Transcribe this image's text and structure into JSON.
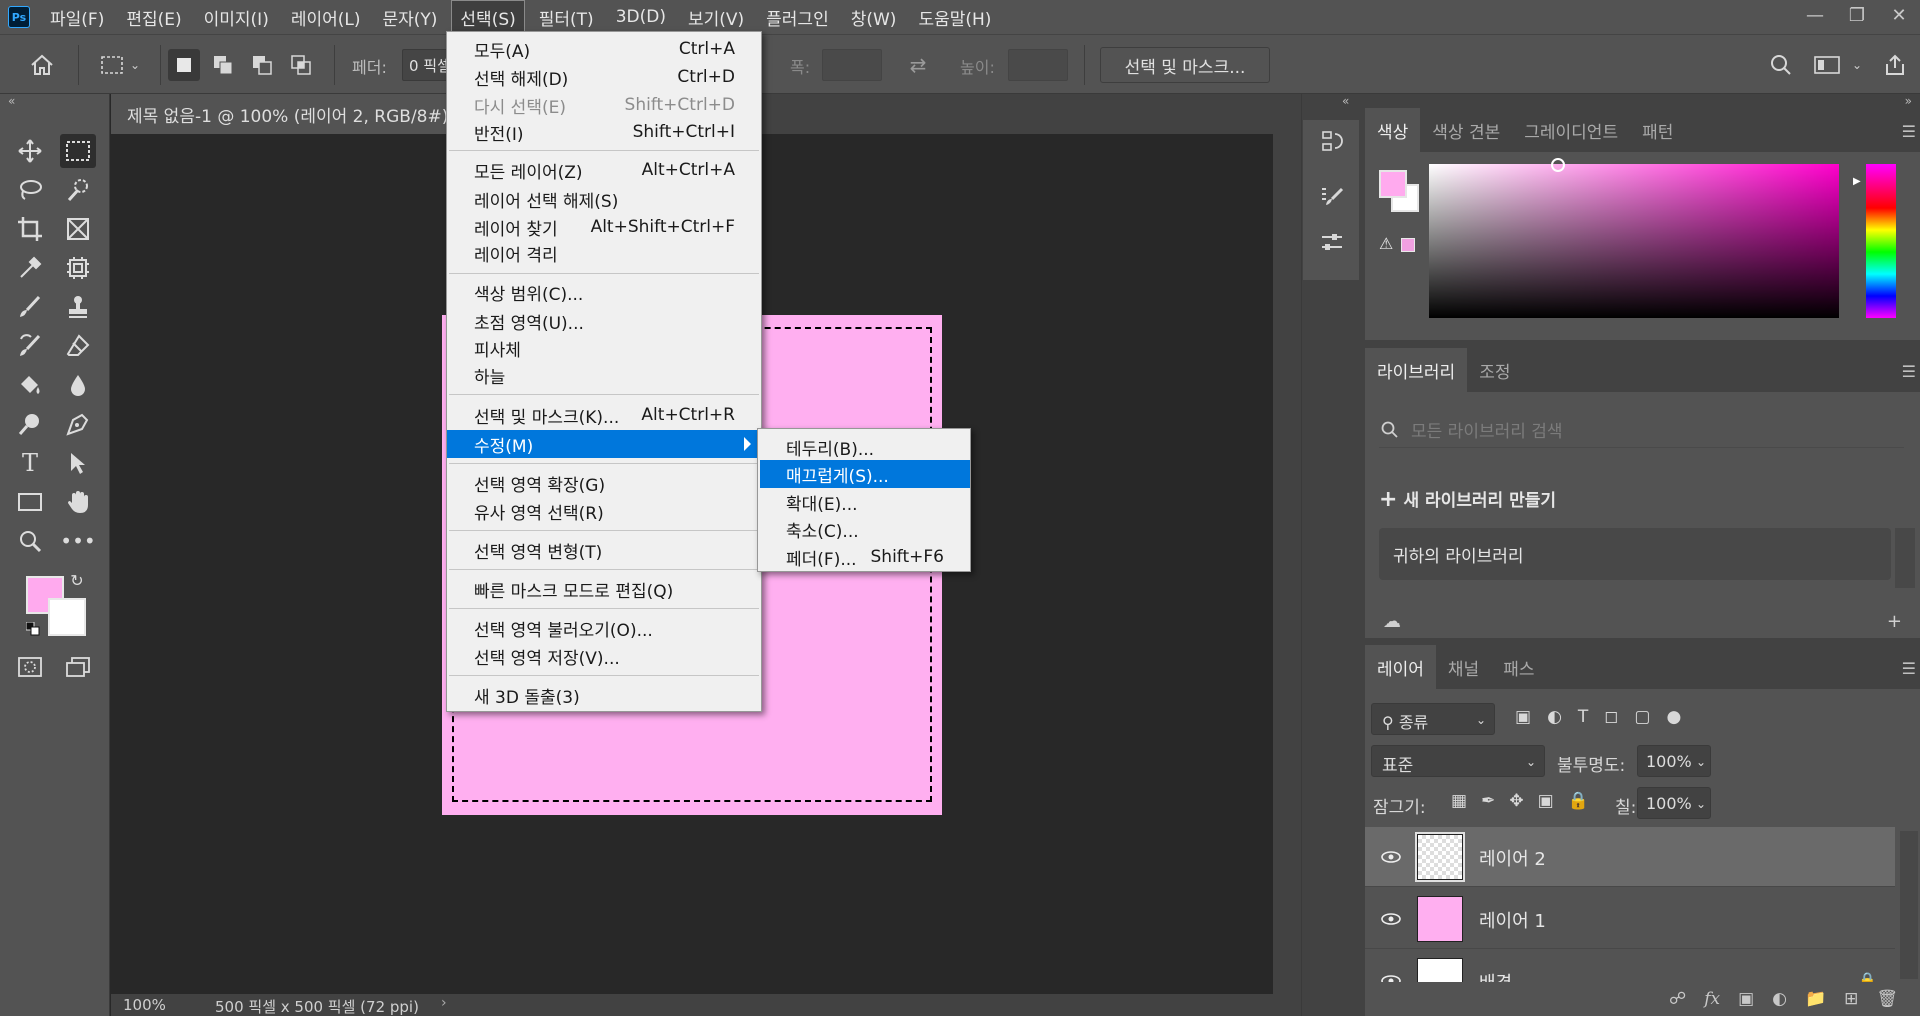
{
  "menubar": {
    "logo": "Ps",
    "items": [
      "파일(F)",
      "편집(E)",
      "이미지(I)",
      "레이어(L)",
      "문자(Y)",
      "선택(S)",
      "필터(T)",
      "3D(D)",
      "보기(V)",
      "플러그인",
      "창(W)",
      "도움말(H)"
    ],
    "active_index": 5
  },
  "options": {
    "feather_label": "페더:",
    "feather_value": "0 픽셀",
    "width_label": "폭:",
    "height_label": "높이:",
    "select_mask_button": "선택 및 마스크..."
  },
  "document": {
    "tab_title": "제목 없음-1 @ 100% (레이어 2, RGB/8#)",
    "canvas_color": "#ffaff0"
  },
  "status": {
    "zoom": "100%",
    "info": "500 픽셀 x 500 픽셀 (72 ppi)"
  },
  "select_menu": {
    "items": [
      {
        "label": "모두(A)",
        "shortcut": "Ctrl+A"
      },
      {
        "label": "선택 해제(D)",
        "shortcut": "Ctrl+D"
      },
      {
        "label": "다시 선택(E)",
        "shortcut": "Shift+Ctrl+D"
      },
      {
        "label": "반전(I)",
        "shortcut": "Shift+Ctrl+I"
      },
      {
        "label": "모든 레이어(Z)",
        "shortcut": "Alt+Ctrl+A"
      },
      {
        "label": "레이어 선택 해제(S)",
        "shortcut": ""
      },
      {
        "label": "레이어 찾기",
        "shortcut": "Alt+Shift+Ctrl+F"
      },
      {
        "label": "레이어 격리",
        "shortcut": ""
      },
      {
        "label": "색상 범위(C)...",
        "shortcut": ""
      },
      {
        "label": "초점 영역(U)...",
        "shortcut": ""
      },
      {
        "label": "피사체",
        "shortcut": ""
      },
      {
        "label": "하늘",
        "shortcut": ""
      },
      {
        "label": "선택 및 마스크(K)...",
        "shortcut": "Alt+Ctrl+R"
      },
      {
        "label": "수정(M)",
        "shortcut": ""
      },
      {
        "label": "선택 영역 확장(G)",
        "shortcut": ""
      },
      {
        "label": "유사 영역 선택(R)",
        "shortcut": ""
      },
      {
        "label": "선택 영역 변형(T)",
        "shortcut": ""
      },
      {
        "label": "빠른 마스크 모드로 편집(Q)",
        "shortcut": ""
      },
      {
        "label": "선택 영역 불러오기(O)...",
        "shortcut": ""
      },
      {
        "label": "선택 영역 저장(V)...",
        "shortcut": ""
      },
      {
        "label": "새 3D 돌출(3)",
        "shortcut": ""
      }
    ]
  },
  "modify_submenu": {
    "items": [
      {
        "label": "테두리(B)...",
        "shortcut": ""
      },
      {
        "label": "매끄럽게(S)...",
        "shortcut": ""
      },
      {
        "label": "확대(E)...",
        "shortcut": ""
      },
      {
        "label": "축소(C)...",
        "shortcut": ""
      },
      {
        "label": "페더(F)...",
        "shortcut": "Shift+F6"
      }
    ]
  },
  "color_panel": {
    "tabs": [
      "색상",
      "색상 견본",
      "그레이디언트",
      "패턴"
    ],
    "fg_color": "#ffaaee",
    "bg_color": "#ffffff"
  },
  "library_panel": {
    "tabs": [
      "라이브러리",
      "조정"
    ],
    "search_placeholder": "모든 라이브러리 검색",
    "new_library": "새 라이브러리 만들기",
    "library_item": "귀하의 라이브러리"
  },
  "layers_panel": {
    "tabs": [
      "레이어",
      "채널",
      "패스"
    ],
    "filter": "종류",
    "blend_mode": "표준",
    "opacity_label": "불투명도:",
    "opacity_value": "100%",
    "lock_label": "잠그기:",
    "fill_label": "칠:",
    "fill_value": "100%",
    "layers": [
      {
        "name": "레이어 2",
        "selected": true
      },
      {
        "name": "레이어 1",
        "selected": false
      },
      {
        "name": "배경",
        "selected": false
      }
    ]
  }
}
